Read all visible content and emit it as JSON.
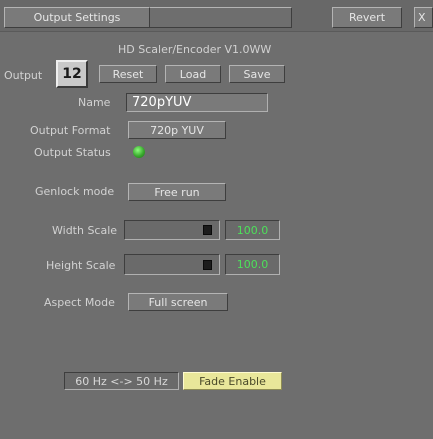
{
  "toolbar": {
    "panel_button": "Output Settings",
    "revert_button": "Revert",
    "close_button": "X"
  },
  "device": {
    "title": "HD Scaler/Encoder V1.0WW",
    "output_label": "Output",
    "output_number": "12",
    "reset_button": "Reset",
    "load_button": "Load",
    "save_button": "Save"
  },
  "fields": {
    "name_label": "Name",
    "name_value": "720pYUV",
    "output_format_label": "Output Format",
    "output_format_value": "720p YUV",
    "output_status_label": "Output Status",
    "genlock_label": "Genlock mode",
    "genlock_value": "Free run",
    "width_scale_label": "Width Scale",
    "width_scale_value": "100.0",
    "height_scale_label": "Height Scale",
    "height_scale_value": "100.0",
    "aspect_label": "Aspect Mode",
    "aspect_value": "Full screen"
  },
  "footer": {
    "hz_button": "60 Hz <-> 50 Hz",
    "fade_button": "Fade Enable"
  },
  "colors": {
    "background": "#6e6e6e",
    "status_led": "#3aaa2e",
    "value_green": "#4de05a",
    "fade_highlight": "#e9e79a"
  },
  "sliders": {
    "width_scale_level": 1.0,
    "height_scale_level": 1.0
  }
}
